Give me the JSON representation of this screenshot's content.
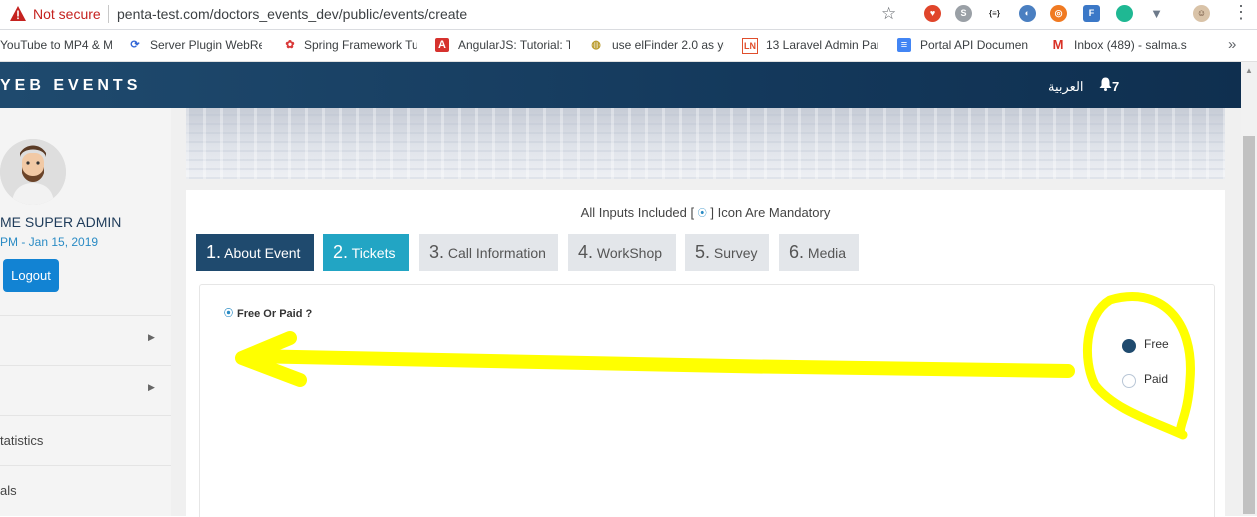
{
  "browser": {
    "not_secure_label": "Not secure",
    "url": "penta-test.com/doctors_events_dev/public/events/create",
    "bookmarks": [
      {
        "label": "YouTube to MP4 & M",
        "icon": "bookmark-icon"
      },
      {
        "label": "Server Plugin WebRe",
        "icon": "plugin-icon"
      },
      {
        "label": "Spring Framework Tu",
        "icon": "spring-icon"
      },
      {
        "label": "AngularJS: Tutorial: T",
        "icon": "angular-icon"
      },
      {
        "label": "use elFinder 2.0 as yo",
        "icon": "elfinder-icon"
      },
      {
        "label": "13 Laravel Admin Pan",
        "icon": "laravel-icon"
      },
      {
        "label": "Portal API Documen",
        "icon": "document-icon"
      },
      {
        "label": "Inbox (489) - salma.s",
        "icon": "gmail-icon"
      }
    ],
    "more_bookmarks": "»"
  },
  "topbar": {
    "brand": "YEB EVENTS",
    "language": "العربية",
    "notification_count": "7"
  },
  "sidebar": {
    "user_name": "ME SUPER ADMIN",
    "user_date": "PM - Jan 15, 2019",
    "logout_label": "Logout",
    "items": [
      {
        "label": ""
      },
      {
        "label": ""
      },
      {
        "label": "tatistics"
      },
      {
        "label": "als"
      }
    ]
  },
  "main": {
    "mandatory_prefix": "All Inputs Included [",
    "mandatory_suffix": "] Icon Are Mandatory",
    "tabs": [
      {
        "num": "1.",
        "label": "About Event"
      },
      {
        "num": "2.",
        "label": "Tickets"
      },
      {
        "num": "3.",
        "label": "Call Information"
      },
      {
        "num": "4.",
        "label": "WorkShop"
      },
      {
        "num": "5.",
        "label": "Survey"
      },
      {
        "num": "6.",
        "label": "Media"
      }
    ],
    "free_or_paid_label": "Free Or Paid ?",
    "options": [
      {
        "label": "Free",
        "selected": true
      },
      {
        "label": "Paid",
        "selected": false
      }
    ]
  },
  "colors": {
    "navbar": "#1f4a6e",
    "tab_active": "#1f4a6e",
    "tab_current": "#22a5c4",
    "annotation": "#ffff00",
    "logout": "#1283d3"
  }
}
